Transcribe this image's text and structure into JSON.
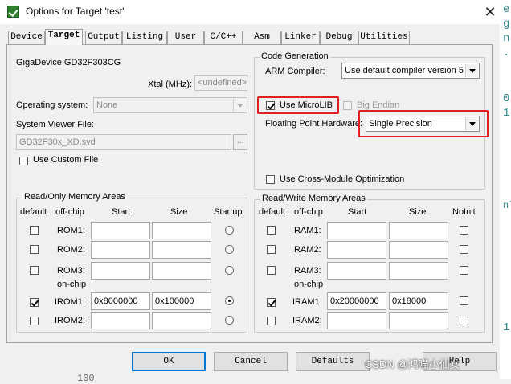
{
  "window": {
    "title": "Options for Target 'test'",
    "close_glyph": "✕"
  },
  "tabs": [
    {
      "label": "Device"
    },
    {
      "label": "Target"
    },
    {
      "label": "Output"
    },
    {
      "label": "Listing"
    },
    {
      "label": "User"
    },
    {
      "label": "C/C++"
    },
    {
      "label": "Asm"
    },
    {
      "label": "Linker"
    },
    {
      "label": "Debug"
    },
    {
      "label": "Utilities"
    }
  ],
  "active_tab": "Target",
  "device": {
    "name": "GigaDevice GD32F303CG"
  },
  "xtal": {
    "label": "Xtal (MHz):",
    "value": "<undefined>"
  },
  "os": {
    "label": "Operating system:",
    "value": "None"
  },
  "svd": {
    "label": "System Viewer File:",
    "value": "GD32F30x_XD.svd",
    "browse": "..."
  },
  "custom_file": {
    "label": "Use Custom File",
    "checked": false
  },
  "codegen": {
    "title": "Code Generation",
    "arm_compiler_label": "ARM Compiler:",
    "arm_compiler_value": "Use default compiler version 5",
    "microlib_label": "Use MicroLIB",
    "microlib_checked": true,
    "big_endian_label": "Big Endian",
    "fph_label": "Floating Point Hardware:",
    "fph_value": "Single Precision",
    "cross_module_label": "Use Cross-Module Optimization"
  },
  "rom_group": {
    "title": "Read/Only Memory Areas",
    "headers": {
      "default": "default",
      "offchip": "off-chip",
      "start": "Start",
      "size": "Size",
      "startup": "Startup"
    },
    "onchip_label": "on-chip",
    "rows": [
      {
        "name": "ROM1:",
        "default": false,
        "start": "",
        "size": "",
        "startup": false
      },
      {
        "name": "ROM2:",
        "default": false,
        "start": "",
        "size": "",
        "startup": false
      },
      {
        "name": "ROM3:",
        "default": false,
        "start": "",
        "size": "",
        "startup": false
      },
      {
        "name": "IROM1:",
        "default": true,
        "start": "0x8000000",
        "size": "0x100000",
        "startup": true
      },
      {
        "name": "IROM2:",
        "default": false,
        "start": "",
        "size": "",
        "startup": false
      }
    ]
  },
  "ram_group": {
    "title": "Read/Write Memory Areas",
    "headers": {
      "default": "default",
      "offchip": "off-chip",
      "start": "Start",
      "size": "Size",
      "noinit": "NoInit"
    },
    "onchip_label": "on-chip",
    "rows": [
      {
        "name": "RAM1:",
        "default": false,
        "start": "",
        "size": "",
        "noinit": false
      },
      {
        "name": "RAM2:",
        "default": false,
        "start": "",
        "size": "",
        "noinit": false
      },
      {
        "name": "RAM3:",
        "default": false,
        "start": "",
        "size": "",
        "noinit": false
      },
      {
        "name": "IRAM1:",
        "default": true,
        "start": "0x20000000",
        "size": "0x18000",
        "noinit": false
      },
      {
        "name": "IRAM2:",
        "default": false,
        "start": "",
        "size": "",
        "noinit": false
      }
    ]
  },
  "buttons": {
    "ok": "OK",
    "cancel": "Cancel",
    "defaults": "Defaults",
    "help": "Help"
  },
  "watermark": "CSDN @鸿喵小仙女",
  "editor_chars": [
    "e",
    "g",
    "n",
    ".",
    "0",
    "1",
    "nl",
    "1"
  ],
  "bottom_text": "100",
  "colors": {
    "highlight_box": "#e02020",
    "default_button": "#0078d7"
  }
}
